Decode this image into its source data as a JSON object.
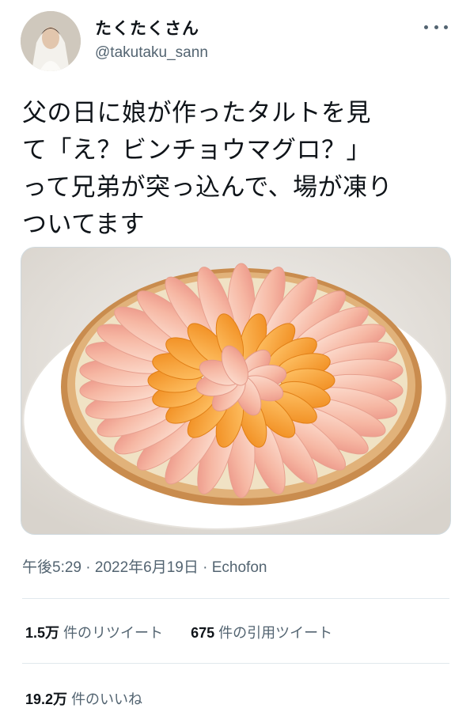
{
  "author": {
    "display_name": "たくたくさん",
    "handle": "@takutaku_sann"
  },
  "tweet": {
    "lines": [
      "父の日に娘が作ったタルトを見",
      "て「え？ビンチョウマグロ？」",
      "って兄弟が突っ込んで、場が凍り",
      "ついてます"
    ]
  },
  "meta": {
    "time": "午後5:29",
    "separator": "·",
    "date": "2022年6月19日",
    "source": "Echofon"
  },
  "stats": {
    "retweets": {
      "count": "1.5万",
      "label": "件のリツイート"
    },
    "quotes": {
      "count": "675",
      "label": "件の引用ツイート"
    },
    "likes": {
      "count": "19.2万",
      "label": "件のいいね"
    }
  },
  "icons": {
    "more": "more-horizontal-icon"
  },
  "colors": {
    "text": "#0f1419",
    "secondary": "#536471",
    "divider": "#e1e8ed"
  }
}
